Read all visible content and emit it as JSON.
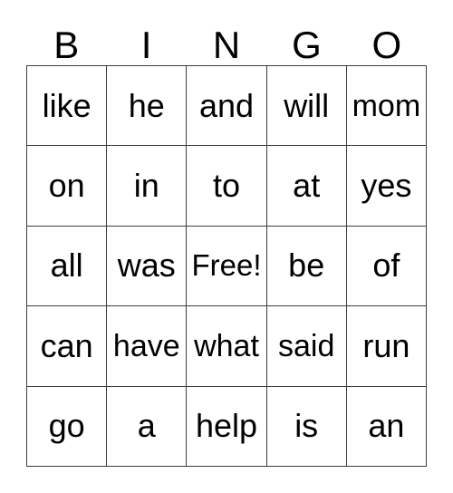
{
  "card": {
    "title": "BINGO",
    "header_letters": [
      "B",
      "I",
      "N",
      "G",
      "O"
    ],
    "free_space_label": "Free!",
    "free_space_position": {
      "row": 3,
      "column": 3
    },
    "grid_size": "5x5",
    "colors": {
      "background": "#ffffff",
      "text": "#000000",
      "grid_line": "#3d3d3d"
    },
    "rows": [
      {
        "cells": [
          {
            "text": "like",
            "free": false
          },
          {
            "text": "he",
            "free": false
          },
          {
            "text": "and",
            "free": false
          },
          {
            "text": "will",
            "free": false
          },
          {
            "text": "mom",
            "free": false
          }
        ]
      },
      {
        "cells": [
          {
            "text": "on",
            "free": false
          },
          {
            "text": "in",
            "free": false
          },
          {
            "text": "to",
            "free": false
          },
          {
            "text": "at",
            "free": false
          },
          {
            "text": "yes",
            "free": false
          }
        ]
      },
      {
        "cells": [
          {
            "text": "all",
            "free": false
          },
          {
            "text": "was",
            "free": false
          },
          {
            "text": "Free!",
            "free": true
          },
          {
            "text": "be",
            "free": false
          },
          {
            "text": "of",
            "free": false
          }
        ]
      },
      {
        "cells": [
          {
            "text": "can",
            "free": false
          },
          {
            "text": "have",
            "free": false
          },
          {
            "text": "what",
            "free": false
          },
          {
            "text": "said",
            "free": false
          },
          {
            "text": "run",
            "free": false
          }
        ]
      },
      {
        "cells": [
          {
            "text": "go",
            "free": false
          },
          {
            "text": "a",
            "free": false
          },
          {
            "text": "help",
            "free": false
          },
          {
            "text": "is",
            "free": false
          },
          {
            "text": "an",
            "free": false
          }
        ]
      }
    ]
  }
}
